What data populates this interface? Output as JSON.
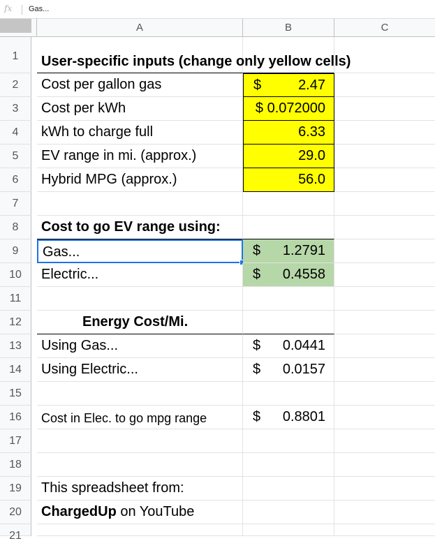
{
  "formula_bar": {
    "fx_label": "fx",
    "value": "Gas..."
  },
  "columns": [
    "A",
    "B",
    "C"
  ],
  "rows": [
    {
      "num": "1",
      "a": "User-specific inputs (change only yellow cells)",
      "b_cur": "",
      "b_val": ""
    },
    {
      "num": "2",
      "a": "Cost per gallon gas",
      "b_cur": "$",
      "b_val": "2.47"
    },
    {
      "num": "3",
      "a": "Cost per kWh",
      "b_cur": "",
      "b_val": "$ 0.072000"
    },
    {
      "num": "4",
      "a": "kWh to charge full",
      "b_cur": "",
      "b_val": "6.33"
    },
    {
      "num": "5",
      "a": "EV range in mi. (approx.)",
      "b_cur": "",
      "b_val": "29.0"
    },
    {
      "num": "6",
      "a": "Hybrid MPG (approx.)",
      "b_cur": "",
      "b_val": "56.0"
    },
    {
      "num": "7",
      "a": "",
      "b_cur": "",
      "b_val": ""
    },
    {
      "num": "8",
      "a": "Cost to go EV range using:",
      "b_cur": "",
      "b_val": ""
    },
    {
      "num": "9",
      "a": "Gas...",
      "b_cur": "$",
      "b_val": "1.2791"
    },
    {
      "num": "10",
      "a": "Electric...",
      "b_cur": "$",
      "b_val": "0.4558"
    },
    {
      "num": "11",
      "a": "",
      "b_cur": "",
      "b_val": ""
    },
    {
      "num": "12",
      "a": "Energy Cost/Mi.",
      "b_cur": "",
      "b_val": ""
    },
    {
      "num": "13",
      "a": "Using Gas...",
      "b_cur": "$",
      "b_val": "0.0441"
    },
    {
      "num": "14",
      "a": "Using Electric...",
      "b_cur": "$",
      "b_val": "0.0157"
    },
    {
      "num": "15",
      "a": "",
      "b_cur": "",
      "b_val": ""
    },
    {
      "num": "16",
      "a": "Cost in Elec. to go mpg range",
      "b_cur": "$",
      "b_val": "0.8801"
    },
    {
      "num": "17",
      "a": "",
      "b_cur": "",
      "b_val": ""
    },
    {
      "num": "18",
      "a": "",
      "b_cur": "",
      "b_val": ""
    },
    {
      "num": "19",
      "a": "This spreadsheet from:",
      "b_cur": "",
      "b_val": ""
    },
    {
      "num": "20",
      "a_bold": "ChargedUp",
      "a": " on YouTube",
      "b_cur": "",
      "b_val": ""
    },
    {
      "num": "21",
      "a": "",
      "b_cur": "",
      "b_val": ""
    }
  ],
  "colors": {
    "yellow": "#ffff00",
    "green": "#b6d7a8",
    "selection": "#1a73e8"
  }
}
